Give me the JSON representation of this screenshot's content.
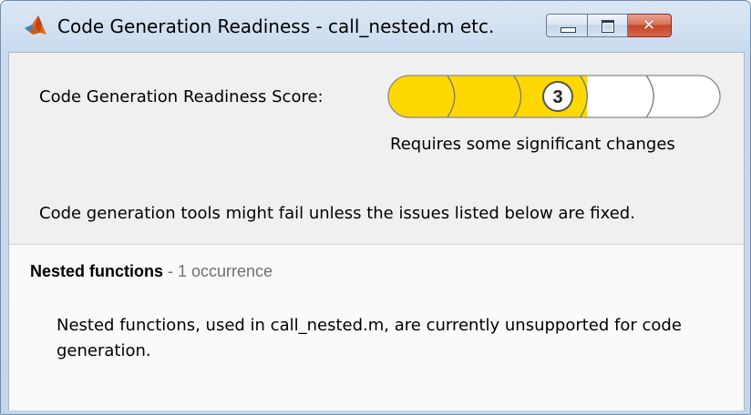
{
  "window": {
    "title": "Code Generation Readiness - call_nested.m etc.",
    "icon": "matlab-logo-icon",
    "controls": {
      "minimize_icon": "minimize-icon",
      "maximize_icon": "maximize-icon",
      "close_icon": "close-icon",
      "close_glyph": "✕"
    }
  },
  "readiness": {
    "score_label": "Code Generation Readiness Score:",
    "score": "3",
    "score_max": 5,
    "score_description": "Requires some significant changes",
    "warning": "Code generation tools might fail unless the issues listed below are fixed."
  },
  "issues": [
    {
      "name": "Nested functions",
      "separator": " - ",
      "occurrences": "1 occurrence",
      "description": "Nested functions, used in call_nested.m, are currently unsupported for code generation."
    }
  ],
  "colors": {
    "score_fill": "#ffd800",
    "score_empty": "#ffffff",
    "titlebar": "#c9daee",
    "close_button": "#c7462a"
  }
}
